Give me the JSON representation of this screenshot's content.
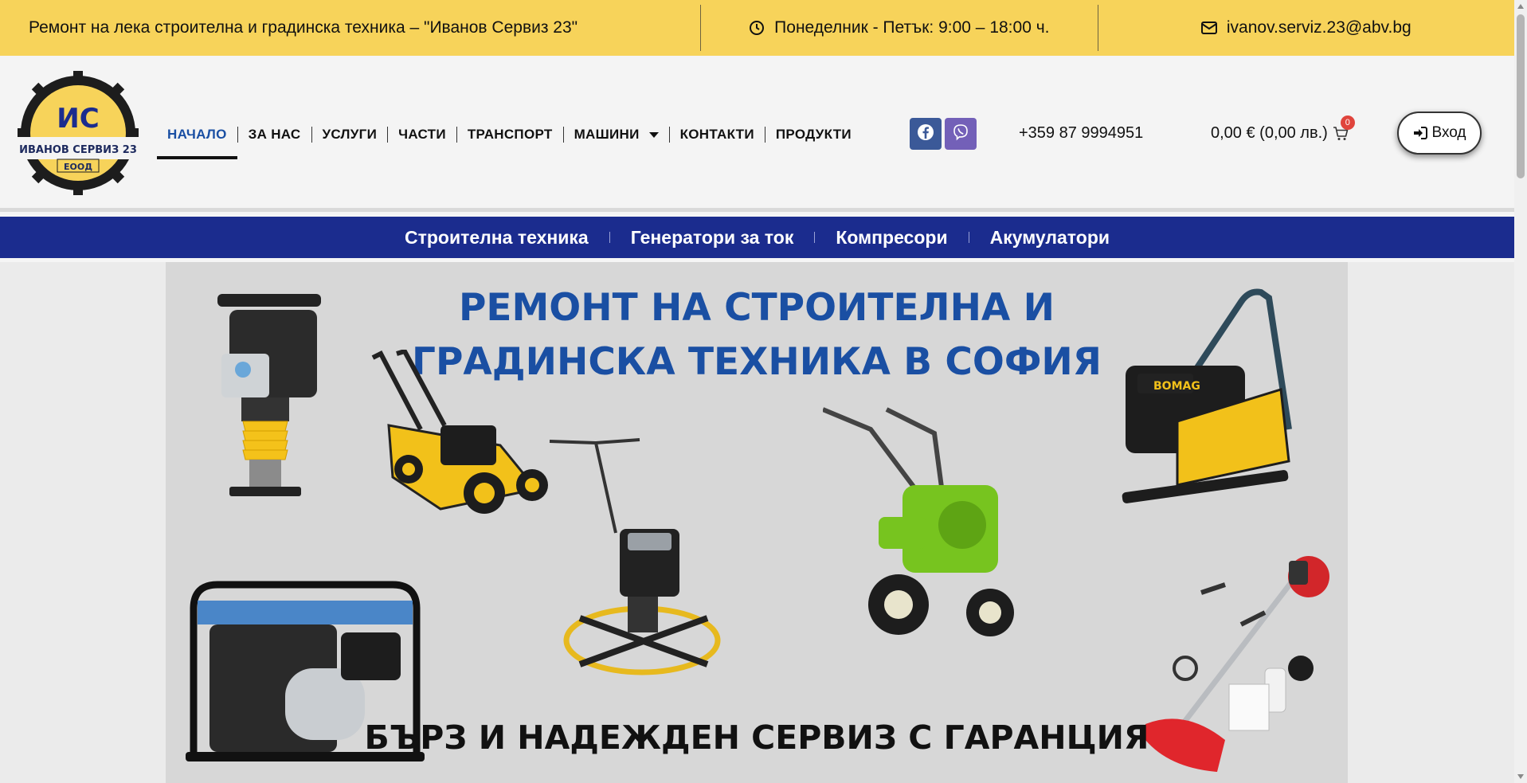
{
  "topbar": {
    "tagline": "Ремонт на лека строителна и градинска техника – \"Иванов Сервиз 23\"",
    "hours": "Понеделник - Петък: 9:00 – 18:00 ч.",
    "email": "ivanov.serviz.23@abv.bg"
  },
  "logo": {
    "initials": "ИС",
    "name": "ИВАНОВ СЕРВИЗ 23",
    "suffix": "ЕООД"
  },
  "nav": {
    "items": [
      {
        "label": "НАЧАЛО",
        "active": true
      },
      {
        "label": "ЗА НАС"
      },
      {
        "label": "УСЛУГИ"
      },
      {
        "label": "ЧАСТИ"
      },
      {
        "label": "ТРАНСПОРТ"
      },
      {
        "label": "МАШИНИ",
        "dropdown": true
      },
      {
        "label": "КОНТАКТИ"
      },
      {
        "label": "ПРОДУКТИ"
      }
    ]
  },
  "social": {
    "facebook_icon": "facebook-icon",
    "viber_icon": "viber-icon"
  },
  "contact": {
    "phone": "+359 87 9994951"
  },
  "cart": {
    "total": "0,00 € (0,00 лв.)",
    "count": "0"
  },
  "login": {
    "label": "Вход"
  },
  "categories": [
    {
      "label": "Строителна техника"
    },
    {
      "label": "Генератори за ток"
    },
    {
      "label": "Компресори"
    },
    {
      "label": "Акумулатори"
    }
  ],
  "hero": {
    "title_line1": "РЕМОНТ НА СТРОИТЕЛНА И",
    "title_line2": "ГРАДИНСКА ТЕХНИКА В СОФИЯ",
    "subtitle": "БЪРЗ И НАДЕЖДЕН СЕРВИЗ С ГАРАНЦИЯ",
    "brand_on_machine": "BOMAG"
  },
  "colors": {
    "topbar": "#f7d35a",
    "nav_active": "#1a4fa3",
    "category_bar": "#1b2c8e",
    "hero_title": "#1a4fa3"
  }
}
